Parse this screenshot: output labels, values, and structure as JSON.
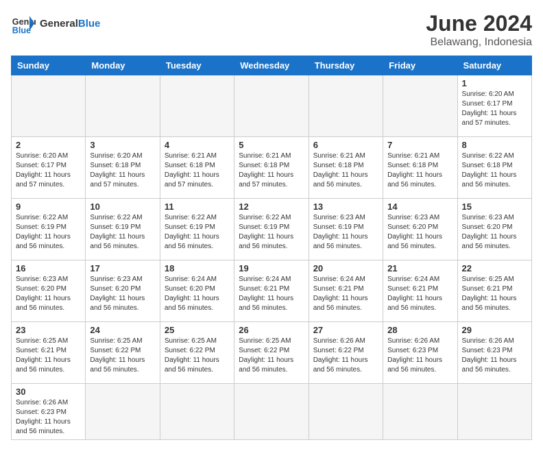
{
  "header": {
    "logo_general": "General",
    "logo_blue": "Blue",
    "month_title": "June 2024",
    "location": "Belawang, Indonesia"
  },
  "weekdays": [
    "Sunday",
    "Monday",
    "Tuesday",
    "Wednesday",
    "Thursday",
    "Friday",
    "Saturday"
  ],
  "days": [
    {
      "date": 1,
      "sunrise": "6:20 AM",
      "sunset": "6:17 PM",
      "daylight": "11 hours and 57 minutes."
    },
    {
      "date": 2,
      "sunrise": "6:20 AM",
      "sunset": "6:17 PM",
      "daylight": "11 hours and 57 minutes."
    },
    {
      "date": 3,
      "sunrise": "6:20 AM",
      "sunset": "6:18 PM",
      "daylight": "11 hours and 57 minutes."
    },
    {
      "date": 4,
      "sunrise": "6:21 AM",
      "sunset": "6:18 PM",
      "daylight": "11 hours and 57 minutes."
    },
    {
      "date": 5,
      "sunrise": "6:21 AM",
      "sunset": "6:18 PM",
      "daylight": "11 hours and 57 minutes."
    },
    {
      "date": 6,
      "sunrise": "6:21 AM",
      "sunset": "6:18 PM",
      "daylight": "11 hours and 56 minutes."
    },
    {
      "date": 7,
      "sunrise": "6:21 AM",
      "sunset": "6:18 PM",
      "daylight": "11 hours and 56 minutes."
    },
    {
      "date": 8,
      "sunrise": "6:22 AM",
      "sunset": "6:18 PM",
      "daylight": "11 hours and 56 minutes."
    },
    {
      "date": 9,
      "sunrise": "6:22 AM",
      "sunset": "6:19 PM",
      "daylight": "11 hours and 56 minutes."
    },
    {
      "date": 10,
      "sunrise": "6:22 AM",
      "sunset": "6:19 PM",
      "daylight": "11 hours and 56 minutes."
    },
    {
      "date": 11,
      "sunrise": "6:22 AM",
      "sunset": "6:19 PM",
      "daylight": "11 hours and 56 minutes."
    },
    {
      "date": 12,
      "sunrise": "6:22 AM",
      "sunset": "6:19 PM",
      "daylight": "11 hours and 56 minutes."
    },
    {
      "date": 13,
      "sunrise": "6:23 AM",
      "sunset": "6:19 PM",
      "daylight": "11 hours and 56 minutes."
    },
    {
      "date": 14,
      "sunrise": "6:23 AM",
      "sunset": "6:20 PM",
      "daylight": "11 hours and 56 minutes."
    },
    {
      "date": 15,
      "sunrise": "6:23 AM",
      "sunset": "6:20 PM",
      "daylight": "11 hours and 56 minutes."
    },
    {
      "date": 16,
      "sunrise": "6:23 AM",
      "sunset": "6:20 PM",
      "daylight": "11 hours and 56 minutes."
    },
    {
      "date": 17,
      "sunrise": "6:23 AM",
      "sunset": "6:20 PM",
      "daylight": "11 hours and 56 minutes."
    },
    {
      "date": 18,
      "sunrise": "6:24 AM",
      "sunset": "6:20 PM",
      "daylight": "11 hours and 56 minutes."
    },
    {
      "date": 19,
      "sunrise": "6:24 AM",
      "sunset": "6:21 PM",
      "daylight": "11 hours and 56 minutes."
    },
    {
      "date": 20,
      "sunrise": "6:24 AM",
      "sunset": "6:21 PM",
      "daylight": "11 hours and 56 minutes."
    },
    {
      "date": 21,
      "sunrise": "6:24 AM",
      "sunset": "6:21 PM",
      "daylight": "11 hours and 56 minutes."
    },
    {
      "date": 22,
      "sunrise": "6:25 AM",
      "sunset": "6:21 PM",
      "daylight": "11 hours and 56 minutes."
    },
    {
      "date": 23,
      "sunrise": "6:25 AM",
      "sunset": "6:21 PM",
      "daylight": "11 hours and 56 minutes."
    },
    {
      "date": 24,
      "sunrise": "6:25 AM",
      "sunset": "6:22 PM",
      "daylight": "11 hours and 56 minutes."
    },
    {
      "date": 25,
      "sunrise": "6:25 AM",
      "sunset": "6:22 PM",
      "daylight": "11 hours and 56 minutes."
    },
    {
      "date": 26,
      "sunrise": "6:25 AM",
      "sunset": "6:22 PM",
      "daylight": "11 hours and 56 minutes."
    },
    {
      "date": 27,
      "sunrise": "6:26 AM",
      "sunset": "6:22 PM",
      "daylight": "11 hours and 56 minutes."
    },
    {
      "date": 28,
      "sunrise": "6:26 AM",
      "sunset": "6:23 PM",
      "daylight": "11 hours and 56 minutes."
    },
    {
      "date": 29,
      "sunrise": "6:26 AM",
      "sunset": "6:23 PM",
      "daylight": "11 hours and 56 minutes."
    },
    {
      "date": 30,
      "sunrise": "6:26 AM",
      "sunset": "6:23 PM",
      "daylight": "11 hours and 56 minutes."
    }
  ]
}
